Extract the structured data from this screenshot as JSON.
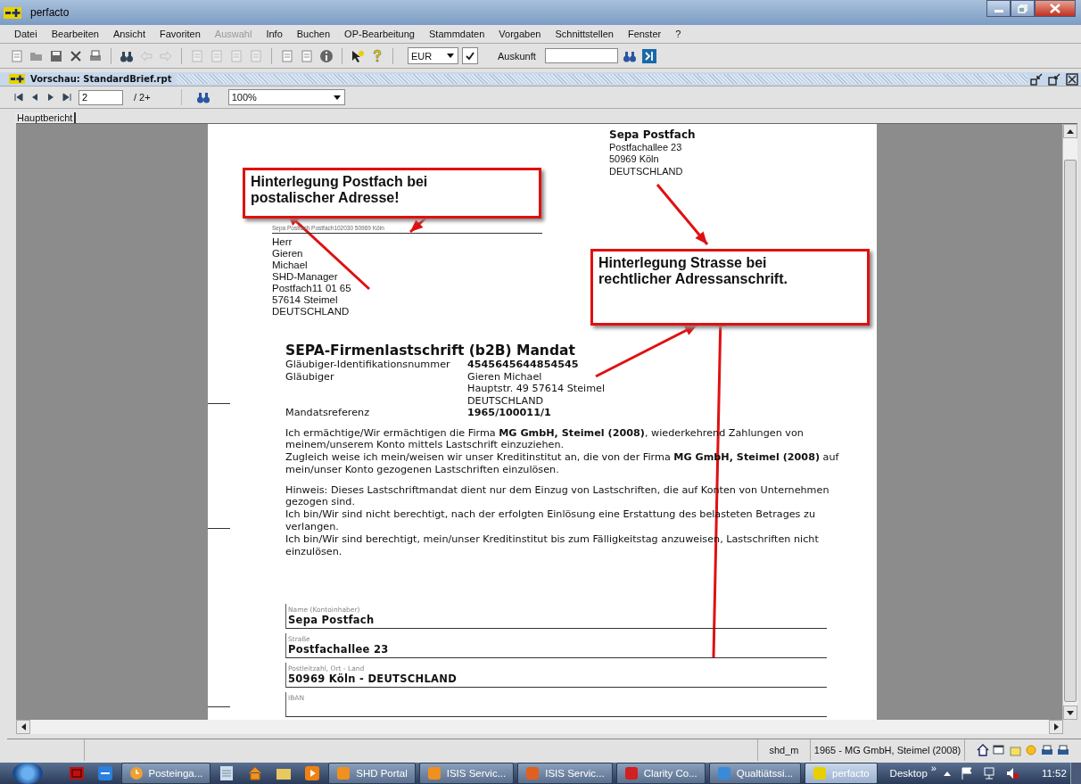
{
  "window": {
    "title": "perfacto"
  },
  "menu": [
    {
      "label": "Datei",
      "disabled": false
    },
    {
      "label": "Bearbeiten",
      "disabled": false
    },
    {
      "label": "Ansicht",
      "disabled": false
    },
    {
      "label": "Favoriten",
      "disabled": false
    },
    {
      "label": "Auswahl",
      "disabled": true
    },
    {
      "label": "Info",
      "disabled": false
    },
    {
      "label": "Buchen",
      "disabled": false
    },
    {
      "label": "OP-Bearbeitung",
      "disabled": false
    },
    {
      "label": "Stammdaten",
      "disabled": false
    },
    {
      "label": "Vorgaben",
      "disabled": false
    },
    {
      "label": "Schnittstellen",
      "disabled": false
    },
    {
      "label": "Fenster",
      "disabled": false
    },
    {
      "label": "?",
      "disabled": false
    }
  ],
  "toolbar": {
    "currency": "EUR",
    "auskunft_label": "Auskunft"
  },
  "document": {
    "title": "Vorschau: StandardBrief.rpt"
  },
  "navigation": {
    "page": "2",
    "page_count": "/ 2+",
    "zoom": "100%"
  },
  "tabs": [
    {
      "label": "Hauptbericht",
      "selected": true
    }
  ],
  "letter": {
    "sender": [
      "Sepa Postfach",
      "Postfachallee 23",
      "50969 Köln",
      "DEUTSCHLAND"
    ],
    "return_address": "Sepa Postfach  Postfach102030 50969 Köln",
    "recipient": [
      "Herr",
      "Gieren",
      "Michael",
      " SHD-Manager",
      "Postfach11 01 65",
      "57614 Steimel",
      "DEUTSCHLAND"
    ],
    "heading": "SEPA-Firmenlastschrift (b2B) Mandat",
    "details": [
      {
        "label": "Gläubiger-Identifikationsnummer",
        "values": [
          "4545645644854545"
        ],
        "bold": true
      },
      {
        "label": "Gläubiger",
        "values": [
          "Gieren Michael",
          "Hauptstr. 49 57614 Steimel",
          "DEUTSCHLAND"
        ],
        "bold": false
      },
      {
        "label": "Mandatsreferenz",
        "values": [
          "1965/100011/1"
        ],
        "bold": true
      }
    ],
    "paragraphs": [
      "Ich ermächtige/Wir ermächtigen die Firma **MG GmbH, Steimel (2008)**, wiederkehrend Zahlungen von meinem/unserem Konto mittels Lastschrift einzuziehen.",
      "Zugleich weise ich mein/weisen wir unser Kreditinstitut an, die von der Firma **MG GmbH, Steimel (2008)** auf mein/unser Konto gezogenen Lastschriften einzulösen."
    ],
    "notes": [
      "Hinweis: Dieses Lastschriftmandat dient nur dem Einzug von Lastschriften, die auf Konten von Unternehmen gezogen sind.",
      "Ich bin/Wir sind nicht berechtigt, nach der erfolgten Einlösung eine Erstattung des belasteten Betrages zu verlangen.",
      "Ich bin/Wir sind berechtigt, mein/unser Kreditinstitut bis zum Fälligkeitstag anzuweisen, Lastschriften nicht einzulösen."
    ],
    "fields": [
      {
        "label": "Name (Kontoinhaber)",
        "value": "Sepa Postfach"
      },
      {
        "label": "Straße",
        "value": "Postfachallee 23"
      },
      {
        "label": "Postleitzahl, Ort - Land",
        "value": "50969 Köln - DEUTSCHLAND"
      },
      {
        "label": "IBAN"
      }
    ]
  },
  "callouts": [
    "Hinterlegung Postfach bei postalischer Adresse!",
    "Hinterlegung Strasse bei rechtlicher Adressanschrift."
  ],
  "status_bar": [
    "shd_m",
    "1965 - MG GmbH, Steimel (2008)"
  ],
  "taskbar": {
    "items": [
      {
        "label": "Posteinga...",
        "selected": false
      },
      {
        "label": "SHD Portal",
        "selected": false
      },
      {
        "label": "ISIS Servic...",
        "selected": false
      },
      {
        "label": "ISIS Servic...",
        "selected": false
      },
      {
        "label": "Clarity Co...",
        "selected": false
      },
      {
        "label": "Qualtiätssi...",
        "selected": false
      },
      {
        "label": "perfacto",
        "selected": true
      }
    ],
    "desktop": "Desktop",
    "chevron": "»",
    "time": "11:52"
  }
}
